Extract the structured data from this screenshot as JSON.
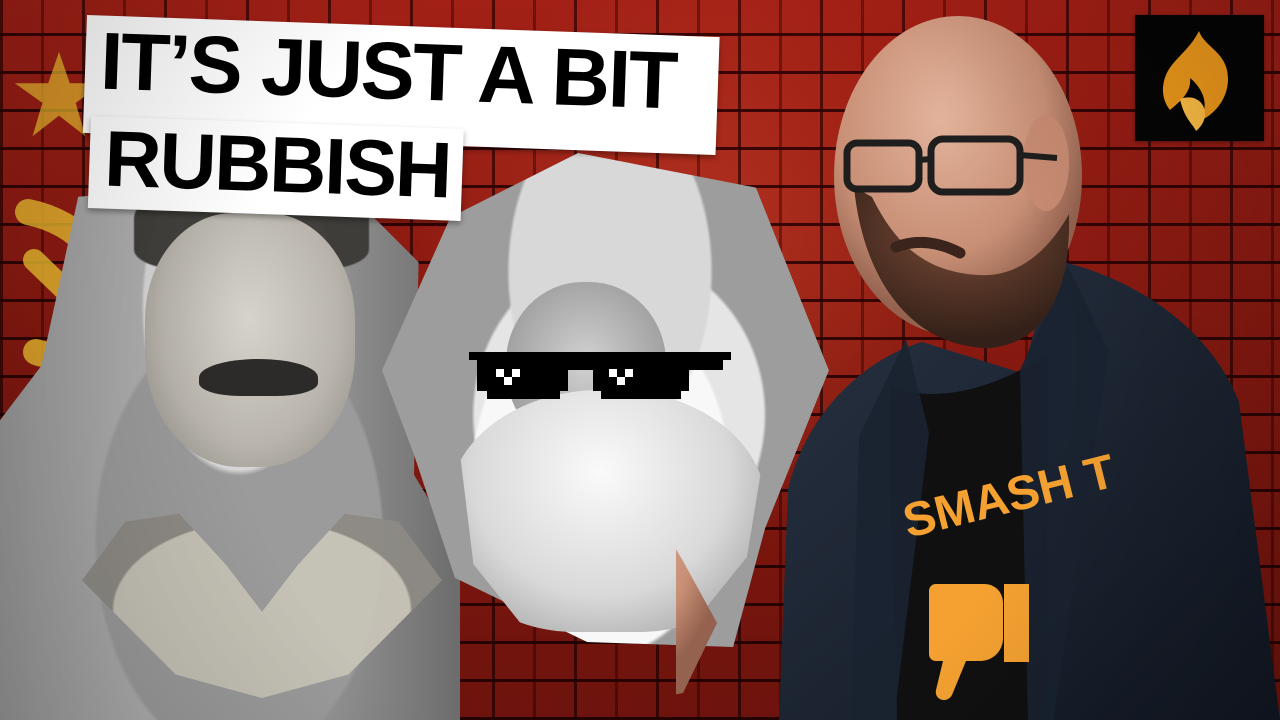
{
  "caption": {
    "line_1": "IT’S JUST A BIT",
    "line_2": "RUBBISH"
  },
  "colors": {
    "wall": "#9f1d13",
    "flag_gold": "#f1c230",
    "caption_background": "#ffffff",
    "caption_text": "#000000",
    "logo_background": "#050505",
    "logo_flame": "#f09a1b",
    "shirt_print": "#f4a131"
  },
  "icons": {
    "channel_logo": "flame-logo-icon",
    "flag_star": "star-icon",
    "flag_emblem": "hammer-and-sickle-icon",
    "sunglasses": "pixel-sunglasses-icon",
    "shirt_graphic": "thumbs-down-icon"
  },
  "shirt": {
    "print_text": "SMASH T"
  }
}
